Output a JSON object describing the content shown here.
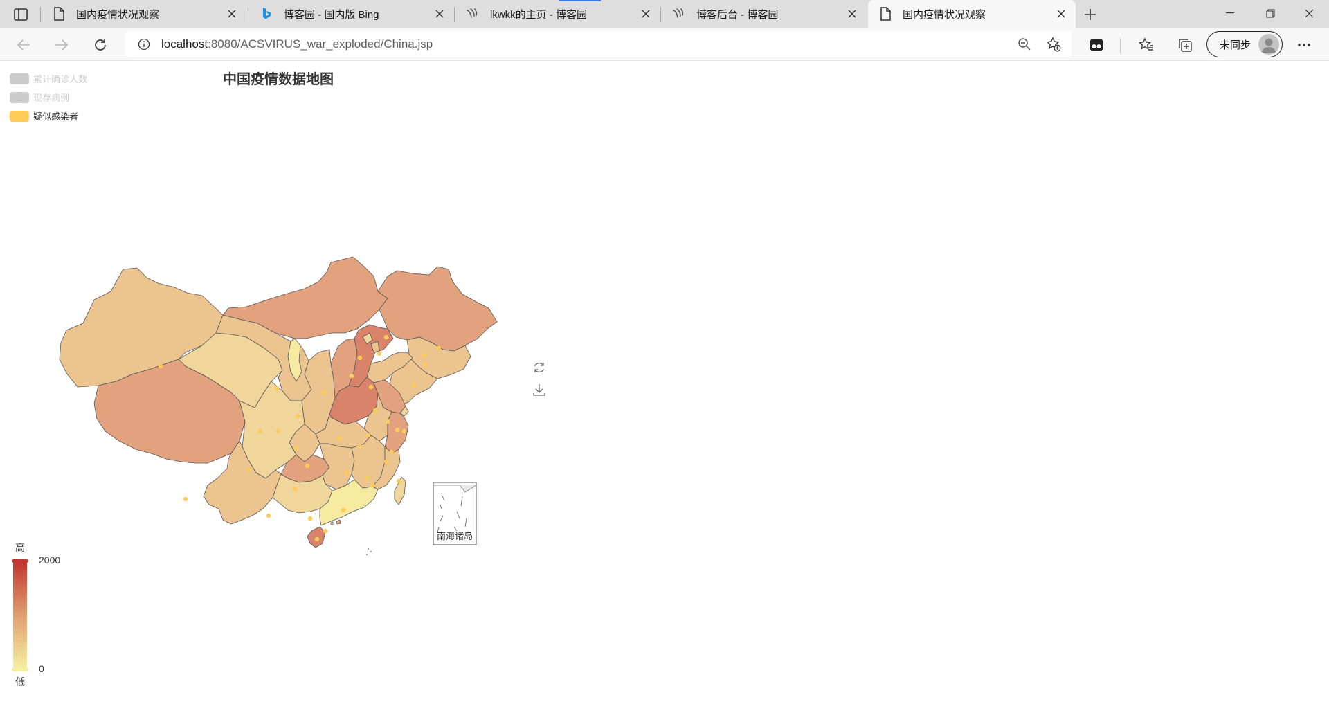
{
  "browser": {
    "tabs": [
      {
        "title": "国内疫情状况观察",
        "favicon": "page-icon",
        "active": false
      },
      {
        "title": "博客园 - 国内版 Bing",
        "favicon": "bing-icon",
        "active": false
      },
      {
        "title": "lkwkk的主页 - 博客园",
        "favicon": "cnblogs-icon",
        "active": false
      },
      {
        "title": "博客后台 - 博客园",
        "favicon": "cnblogs-icon",
        "active": false
      },
      {
        "title": "国内疫情状况观察",
        "favicon": "page-icon",
        "active": true
      }
    ],
    "address": {
      "host": "localhost",
      "path": ":8080/ACSVIRUS_war_exploded/China.jsp"
    },
    "profile_label": "未同步"
  },
  "chart_data": {
    "type": "map",
    "title": "中国疫情数据地图",
    "legend": [
      {
        "name": "累计确诊人数",
        "color": "#cccccc",
        "selected": false
      },
      {
        "name": "现存病例",
        "color": "#cccccc",
        "selected": false
      },
      {
        "name": "疑似感染者",
        "color": "#fdcb57",
        "selected": true
      }
    ],
    "visual_map": {
      "high_label": "高",
      "low_label": "低",
      "max": "2000",
      "min": "0",
      "color_high": "#c23531",
      "color_mid": "#e0a070",
      "color_low": "#f5eda0"
    },
    "inset_label": "南海诸岛",
    "toolbox": [
      "restore-icon",
      "save-image-icon"
    ],
    "colors": {
      "high": "#d9836a",
      "midhigh": "#e2a27e",
      "mid": "#ebc48f",
      "midlow": "#f0d69b",
      "low": "#f5eaa0",
      "point": "#fdcb57",
      "border": "#555555"
    }
  }
}
